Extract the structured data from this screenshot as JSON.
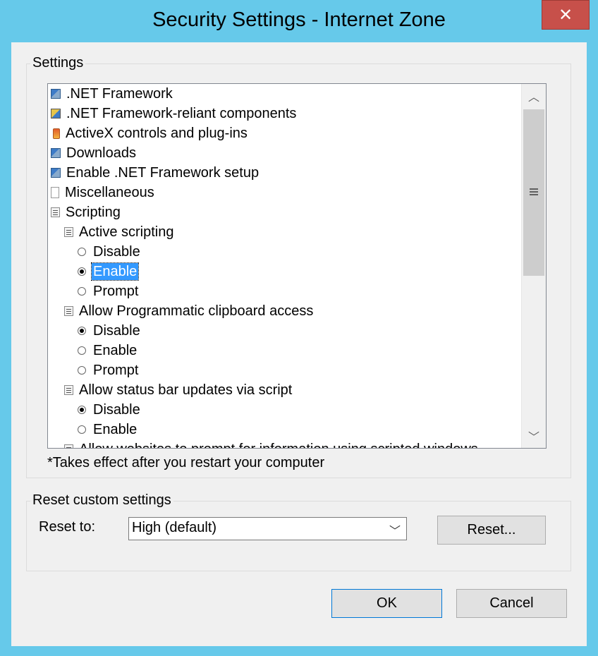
{
  "window": {
    "title": "Security Settings - Internet Zone",
    "close_label": "✕"
  },
  "settings": {
    "group_label": "Settings",
    "items": [
      {
        "label": ".NET Framework",
        "kind": "folder",
        "icon": "net-framework-icon",
        "indent": 0
      },
      {
        "label": ".NET Framework-reliant components",
        "kind": "folder",
        "icon": "net-components-icon",
        "indent": 0
      },
      {
        "label": "ActiveX controls and plug-ins",
        "kind": "folder",
        "icon": "activex-icon",
        "indent": 0
      },
      {
        "label": "Downloads",
        "kind": "folder",
        "icon": "downloads-icon",
        "indent": 0
      },
      {
        "label": "Enable .NET Framework setup",
        "kind": "folder",
        "icon": "net-setup-icon",
        "indent": 0
      },
      {
        "label": "Miscellaneous",
        "kind": "folder",
        "icon": "page-icon",
        "indent": 0
      },
      {
        "label": "Scripting",
        "kind": "folder",
        "icon": "script-icon",
        "indent": 0
      },
      {
        "label": "Active scripting",
        "kind": "setting",
        "icon": "script-icon",
        "indent": 1
      },
      {
        "label": "Disable",
        "kind": "option",
        "checked": false,
        "indent": 2
      },
      {
        "label": "Enable",
        "kind": "option",
        "checked": true,
        "selected": true,
        "indent": 2
      },
      {
        "label": "Prompt",
        "kind": "option",
        "checked": false,
        "indent": 2
      },
      {
        "label": "Allow Programmatic clipboard access",
        "kind": "setting",
        "icon": "script-icon",
        "indent": 1
      },
      {
        "label": "Disable",
        "kind": "option",
        "checked": true,
        "indent": 2
      },
      {
        "label": "Enable",
        "kind": "option",
        "checked": false,
        "indent": 2
      },
      {
        "label": "Prompt",
        "kind": "option",
        "checked": false,
        "indent": 2
      },
      {
        "label": "Allow status bar updates via script",
        "kind": "setting",
        "icon": "script-icon",
        "indent": 1
      },
      {
        "label": "Disable",
        "kind": "option",
        "checked": true,
        "indent": 2
      },
      {
        "label": "Enable",
        "kind": "option",
        "checked": false,
        "indent": 2
      },
      {
        "label": "Allow websites to prompt for information using scripted windows",
        "kind": "setting",
        "icon": "script-icon",
        "indent": 1
      }
    ],
    "note": "*Takes effect after you restart your computer"
  },
  "reset": {
    "group_label": "Reset custom settings",
    "reset_to_label": "Reset to:",
    "reset_to_value": "High (default)",
    "reset_button": "Reset..."
  },
  "buttons": {
    "ok": "OK",
    "cancel": "Cancel"
  }
}
